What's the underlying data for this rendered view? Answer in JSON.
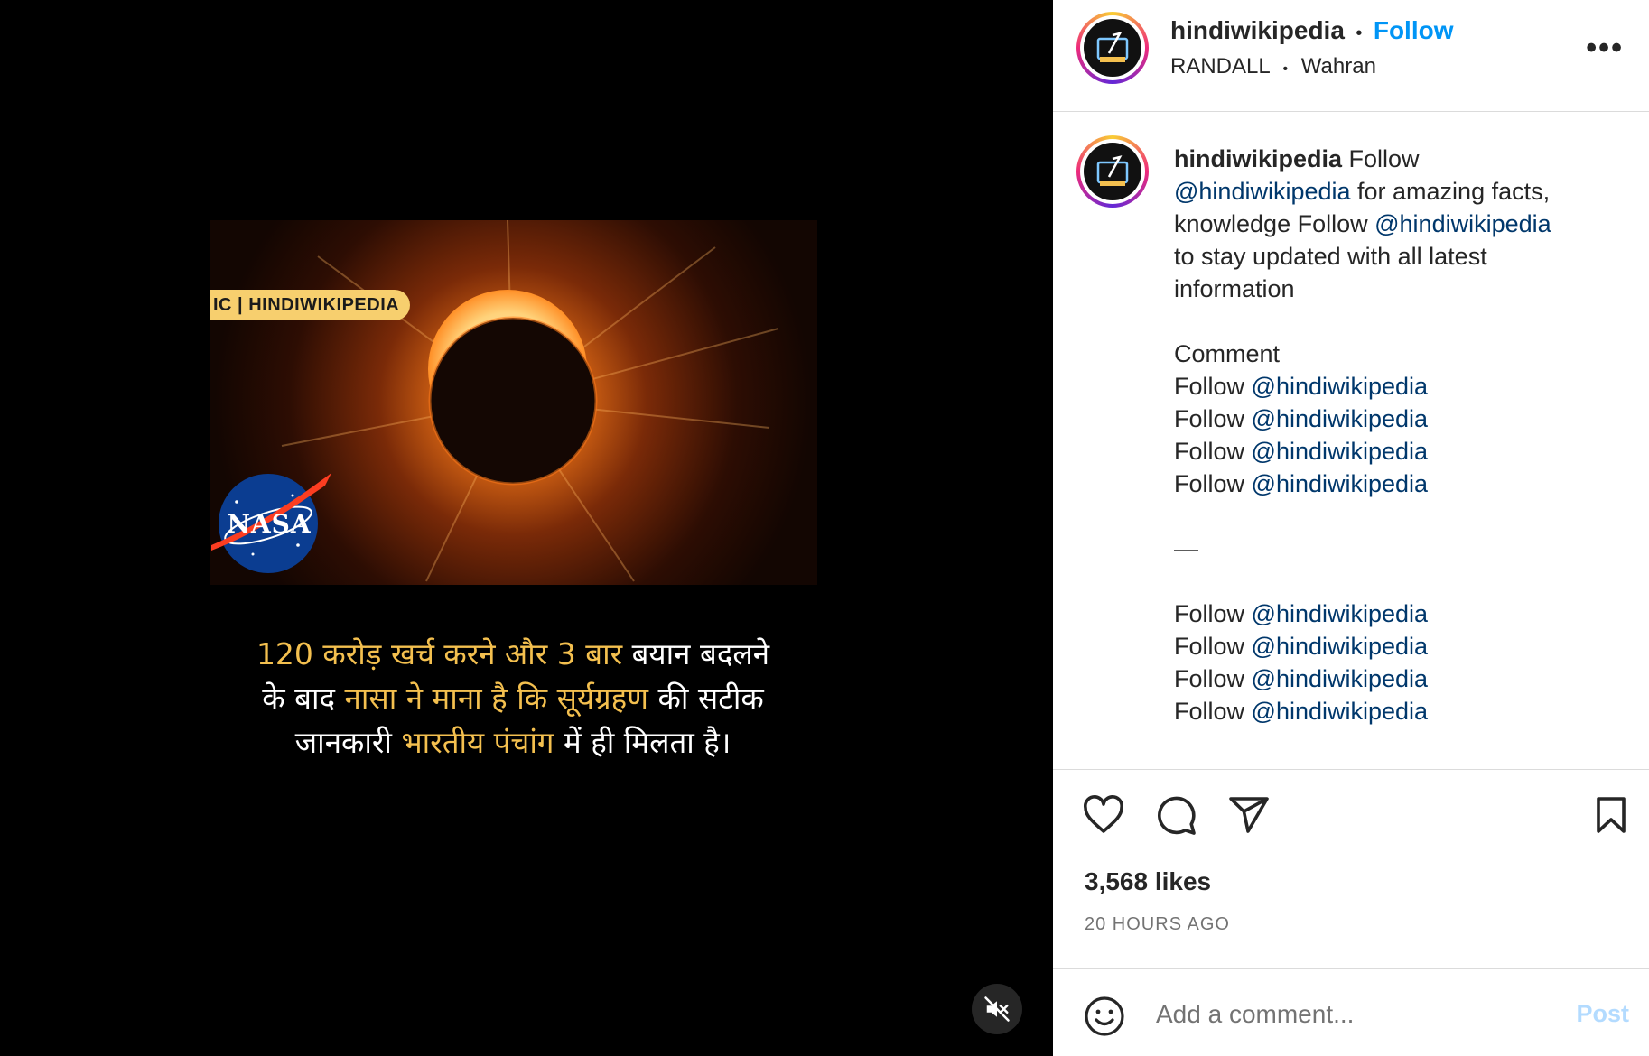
{
  "media": {
    "tag_label": "IC | HINDIWIKIPEDIA",
    "logo_text": "NASA",
    "caption_line1_hl": "120 करोड़ खर्च करने और 3 बार",
    "caption_line1_rest": " बयान बदलने",
    "caption_line2_pre": "के बाद ",
    "caption_line2_hl": "नासा ने माना है कि सूर्यग्रहण",
    "caption_line2_rest": " की सटीक",
    "caption_line3_pre": "जानकारी ",
    "caption_line3_hl": "भारतीय पंचांग",
    "caption_line3_rest": " में ही मिलता है।"
  },
  "header": {
    "username": "hindiwikipedia",
    "separator": "•",
    "follow_label": "Follow",
    "audio": "RANDALL",
    "location": "Wahran",
    "more_label": "•••"
  },
  "post": {
    "username": "hindiwikipedia",
    "l1_follow": " Follow",
    "mention": "@hindiwikipedia",
    "l2_rest": " for amazing facts,",
    "l3_pre": "knowledge Follow ",
    "l4": "to stay updated with all latest",
    "l5": "information",
    "comment_word": "Comment",
    "follow_word": "Follow ",
    "dash": "—"
  },
  "stats": {
    "likes": "3,568 likes",
    "time_ago": "20 HOURS AGO"
  },
  "comment_box": {
    "placeholder": "Add a comment...",
    "post_label": "Post"
  },
  "colors": {
    "follow_blue": "#0095f6",
    "mention_blue": "#00376b",
    "caption_highlight": "#f4c04f"
  }
}
